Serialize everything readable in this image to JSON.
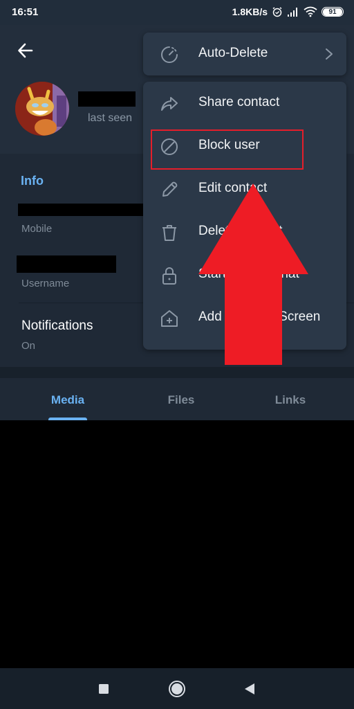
{
  "status_bar": {
    "time": "16:51",
    "net_speed": "1.8KB/s",
    "icons": [
      "alarm-icon",
      "signal-icon",
      "wifi-icon"
    ],
    "battery": "91"
  },
  "header": {
    "back_icon": "arrow-left-icon",
    "last_seen": "last seen"
  },
  "info": {
    "title": "Info",
    "phone_label": "Mobile",
    "username_label": "Username",
    "notifications_label": "Notifications",
    "notifications_value": "On"
  },
  "tabs": [
    {
      "label": "Media",
      "active": true
    },
    {
      "label": "Files",
      "active": false
    },
    {
      "label": "Links",
      "active": false
    }
  ],
  "menu": {
    "auto_delete": {
      "label": "Auto-Delete",
      "icon": "timer-icon"
    },
    "items": [
      {
        "label": "Share contact",
        "icon": "share-icon"
      },
      {
        "label": "Block user",
        "icon": "block-icon",
        "highlighted": true
      },
      {
        "label": "Edit contact",
        "icon": "pencil-icon"
      },
      {
        "label": "Delete contact",
        "icon": "trash-icon"
      },
      {
        "label": "Start Secret Chat",
        "icon": "lock-icon"
      },
      {
        "label": "Add to Home Screen",
        "icon": "home-add-icon"
      }
    ]
  },
  "annotation": {
    "highlight_color": "#e51e2a",
    "arrow_color": "#ee1c25",
    "target": "Block user"
  },
  "nav_bar": {
    "buttons": [
      "recents-button",
      "home-button",
      "back-button"
    ]
  },
  "colors": {
    "accent": "#6ab2f2",
    "header_bg": "#232e3c",
    "menu_bg": "#2b3848"
  }
}
